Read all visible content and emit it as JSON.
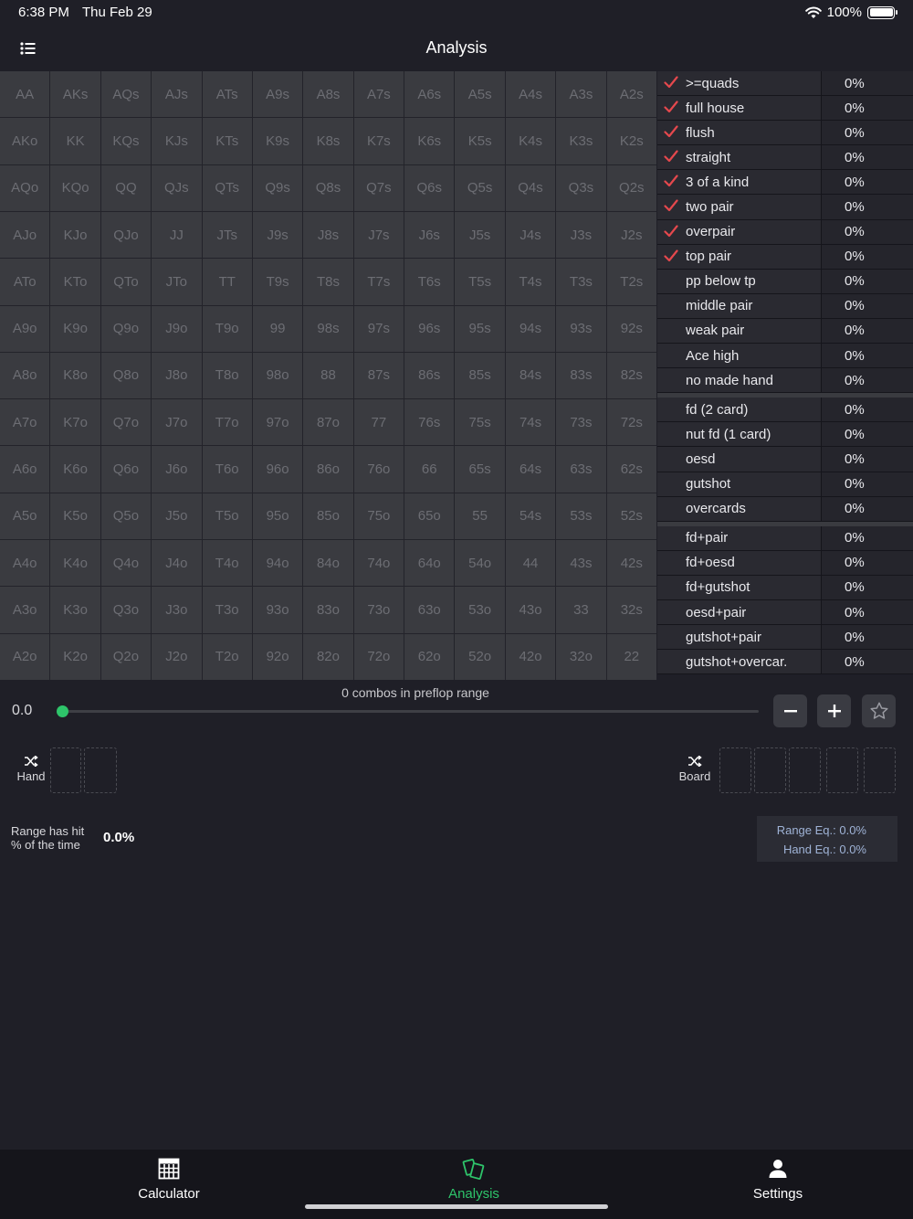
{
  "status": {
    "time": "6:38 PM",
    "date": "Thu Feb 29",
    "battery": "100%"
  },
  "nav": {
    "title": "Analysis"
  },
  "range_grid": [
    [
      "AA",
      "AKs",
      "AQs",
      "AJs",
      "ATs",
      "A9s",
      "A8s",
      "A7s",
      "A6s",
      "A5s",
      "A4s",
      "A3s",
      "A2s"
    ],
    [
      "AKo",
      "KK",
      "KQs",
      "KJs",
      "KTs",
      "K9s",
      "K8s",
      "K7s",
      "K6s",
      "K5s",
      "K4s",
      "K3s",
      "K2s"
    ],
    [
      "AQo",
      "KQo",
      "QQ",
      "QJs",
      "QTs",
      "Q9s",
      "Q8s",
      "Q7s",
      "Q6s",
      "Q5s",
      "Q4s",
      "Q3s",
      "Q2s"
    ],
    [
      "AJo",
      "KJo",
      "QJo",
      "JJ",
      "JTs",
      "J9s",
      "J8s",
      "J7s",
      "J6s",
      "J5s",
      "J4s",
      "J3s",
      "J2s"
    ],
    [
      "ATo",
      "KTo",
      "QTo",
      "JTo",
      "TT",
      "T9s",
      "T8s",
      "T7s",
      "T6s",
      "T5s",
      "T4s",
      "T3s",
      "T2s"
    ],
    [
      "A9o",
      "K9o",
      "Q9o",
      "J9o",
      "T9o",
      "99",
      "98s",
      "97s",
      "96s",
      "95s",
      "94s",
      "93s",
      "92s"
    ],
    [
      "A8o",
      "K8o",
      "Q8o",
      "J8o",
      "T8o",
      "98o",
      "88",
      "87s",
      "86s",
      "85s",
      "84s",
      "83s",
      "82s"
    ],
    [
      "A7o",
      "K7o",
      "Q7o",
      "J7o",
      "T7o",
      "97o",
      "87o",
      "77",
      "76s",
      "75s",
      "74s",
      "73s",
      "72s"
    ],
    [
      "A6o",
      "K6o",
      "Q6o",
      "J6o",
      "T6o",
      "96o",
      "86o",
      "76o",
      "66",
      "65s",
      "64s",
      "63s",
      "62s"
    ],
    [
      "A5o",
      "K5o",
      "Q5o",
      "J5o",
      "T5o",
      "95o",
      "85o",
      "75o",
      "65o",
      "55",
      "54s",
      "53s",
      "52s"
    ],
    [
      "A4o",
      "K4o",
      "Q4o",
      "J4o",
      "T4o",
      "94o",
      "84o",
      "74o",
      "64o",
      "54o",
      "44",
      "43s",
      "42s"
    ],
    [
      "A3o",
      "K3o",
      "Q3o",
      "J3o",
      "T3o",
      "93o",
      "83o",
      "73o",
      "63o",
      "53o",
      "43o",
      "33",
      "32s"
    ],
    [
      "A2o",
      "K2o",
      "Q2o",
      "J2o",
      "T2o",
      "92o",
      "82o",
      "72o",
      "62o",
      "52o",
      "42o",
      "32o",
      "22"
    ]
  ],
  "categories": [
    [
      {
        "name": ">=quads",
        "pct": "0%",
        "checked": true
      },
      {
        "name": "full house",
        "pct": "0%",
        "checked": true
      },
      {
        "name": "flush",
        "pct": "0%",
        "checked": true
      },
      {
        "name": "straight",
        "pct": "0%",
        "checked": true
      },
      {
        "name": "3 of a kind",
        "pct": "0%",
        "checked": true
      },
      {
        "name": "two pair",
        "pct": "0%",
        "checked": true
      },
      {
        "name": "overpair",
        "pct": "0%",
        "checked": true
      },
      {
        "name": "top pair",
        "pct": "0%",
        "checked": true
      },
      {
        "name": "pp below tp",
        "pct": "0%",
        "checked": false
      },
      {
        "name": "middle pair",
        "pct": "0%",
        "checked": false
      },
      {
        "name": "weak pair",
        "pct": "0%",
        "checked": false
      },
      {
        "name": "Ace high",
        "pct": "0%",
        "checked": false
      },
      {
        "name": "no made hand",
        "pct": "0%",
        "checked": false
      }
    ],
    [
      {
        "name": "fd (2 card)",
        "pct": "0%",
        "checked": false
      },
      {
        "name": "nut fd (1 card)",
        "pct": "0%",
        "checked": false
      },
      {
        "name": "oesd",
        "pct": "0%",
        "checked": false
      },
      {
        "name": "gutshot",
        "pct": "0%",
        "checked": false
      },
      {
        "name": "overcards",
        "pct": "0%",
        "checked": false
      }
    ],
    [
      {
        "name": "fd+pair",
        "pct": "0%",
        "checked": false
      },
      {
        "name": "fd+oesd",
        "pct": "0%",
        "checked": false
      },
      {
        "name": "fd+gutshot",
        "pct": "0%",
        "checked": false
      },
      {
        "name": "oesd+pair",
        "pct": "0%",
        "checked": false
      },
      {
        "name": "gutshot+pair",
        "pct": "0%",
        "checked": false
      },
      {
        "name": "gutshot+overcar.",
        "pct": "0%",
        "checked": false
      }
    ]
  ],
  "range": {
    "combos_text": "0 combos in preflop range",
    "slider_value": "0.0",
    "slider_fraction": 0.0
  },
  "hand_picker": {
    "label": "Hand",
    "slots": 2
  },
  "board_picker": {
    "label": "Board",
    "slots": 5
  },
  "hit": {
    "label_line1": "Range has hit",
    "label_line2": "% of the time",
    "value": "0.0%"
  },
  "equity": {
    "range_eq": "Range Eq.: 0.0%",
    "hand_eq": "Hand Eq.: 0.0%"
  },
  "tabs": [
    {
      "label": "Calculator",
      "icon": "calculator-icon",
      "active": false
    },
    {
      "label": "Analysis",
      "icon": "cards-icon",
      "active": true
    },
    {
      "label": "Settings",
      "icon": "person-icon",
      "active": false
    }
  ],
  "colors": {
    "accent": "#2ec46a",
    "check": "#e5484d",
    "equity_text": "#9fb3d6"
  }
}
